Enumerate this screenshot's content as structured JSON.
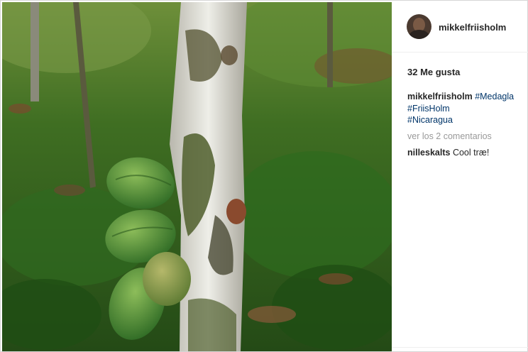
{
  "post": {
    "username": "mikkelfriisholm",
    "likes": "32 Me gusta",
    "caption": {
      "author": "mikkelfriisholm",
      "hashtags": [
        "#Medagla",
        "#FriisHolm",
        "#Nicaragua"
      ]
    },
    "view_comments": "ver los 2 comentarios",
    "comments": [
      {
        "author": "nilleskalts",
        "text": "Cool træ!"
      }
    ]
  },
  "icons": {
    "avatar": "user-avatar"
  },
  "colors": {
    "username": "#262626",
    "hashtag": "#003569",
    "muted": "#999999"
  }
}
